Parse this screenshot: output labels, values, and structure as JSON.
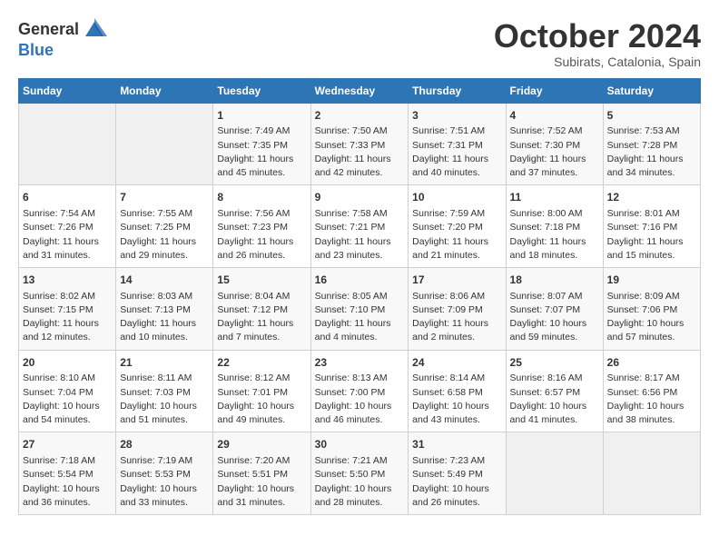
{
  "logo": {
    "line1": "General",
    "line2": "Blue"
  },
  "title": "October 2024",
  "subtitle": "Subirats, Catalonia, Spain",
  "days_of_week": [
    "Sunday",
    "Monday",
    "Tuesday",
    "Wednesday",
    "Thursday",
    "Friday",
    "Saturday"
  ],
  "weeks": [
    [
      {
        "day": "",
        "info": ""
      },
      {
        "day": "",
        "info": ""
      },
      {
        "day": "1",
        "info": "Sunrise: 7:49 AM\nSunset: 7:35 PM\nDaylight: 11 hours and 45 minutes."
      },
      {
        "day": "2",
        "info": "Sunrise: 7:50 AM\nSunset: 7:33 PM\nDaylight: 11 hours and 42 minutes."
      },
      {
        "day": "3",
        "info": "Sunrise: 7:51 AM\nSunset: 7:31 PM\nDaylight: 11 hours and 40 minutes."
      },
      {
        "day": "4",
        "info": "Sunrise: 7:52 AM\nSunset: 7:30 PM\nDaylight: 11 hours and 37 minutes."
      },
      {
        "day": "5",
        "info": "Sunrise: 7:53 AM\nSunset: 7:28 PM\nDaylight: 11 hours and 34 minutes."
      }
    ],
    [
      {
        "day": "6",
        "info": "Sunrise: 7:54 AM\nSunset: 7:26 PM\nDaylight: 11 hours and 31 minutes."
      },
      {
        "day": "7",
        "info": "Sunrise: 7:55 AM\nSunset: 7:25 PM\nDaylight: 11 hours and 29 minutes."
      },
      {
        "day": "8",
        "info": "Sunrise: 7:56 AM\nSunset: 7:23 PM\nDaylight: 11 hours and 26 minutes."
      },
      {
        "day": "9",
        "info": "Sunrise: 7:58 AM\nSunset: 7:21 PM\nDaylight: 11 hours and 23 minutes."
      },
      {
        "day": "10",
        "info": "Sunrise: 7:59 AM\nSunset: 7:20 PM\nDaylight: 11 hours and 21 minutes."
      },
      {
        "day": "11",
        "info": "Sunrise: 8:00 AM\nSunset: 7:18 PM\nDaylight: 11 hours and 18 minutes."
      },
      {
        "day": "12",
        "info": "Sunrise: 8:01 AM\nSunset: 7:16 PM\nDaylight: 11 hours and 15 minutes."
      }
    ],
    [
      {
        "day": "13",
        "info": "Sunrise: 8:02 AM\nSunset: 7:15 PM\nDaylight: 11 hours and 12 minutes."
      },
      {
        "day": "14",
        "info": "Sunrise: 8:03 AM\nSunset: 7:13 PM\nDaylight: 11 hours and 10 minutes."
      },
      {
        "day": "15",
        "info": "Sunrise: 8:04 AM\nSunset: 7:12 PM\nDaylight: 11 hours and 7 minutes."
      },
      {
        "day": "16",
        "info": "Sunrise: 8:05 AM\nSunset: 7:10 PM\nDaylight: 11 hours and 4 minutes."
      },
      {
        "day": "17",
        "info": "Sunrise: 8:06 AM\nSunset: 7:09 PM\nDaylight: 11 hours and 2 minutes."
      },
      {
        "day": "18",
        "info": "Sunrise: 8:07 AM\nSunset: 7:07 PM\nDaylight: 10 hours and 59 minutes."
      },
      {
        "day": "19",
        "info": "Sunrise: 8:09 AM\nSunset: 7:06 PM\nDaylight: 10 hours and 57 minutes."
      }
    ],
    [
      {
        "day": "20",
        "info": "Sunrise: 8:10 AM\nSunset: 7:04 PM\nDaylight: 10 hours and 54 minutes."
      },
      {
        "day": "21",
        "info": "Sunrise: 8:11 AM\nSunset: 7:03 PM\nDaylight: 10 hours and 51 minutes."
      },
      {
        "day": "22",
        "info": "Sunrise: 8:12 AM\nSunset: 7:01 PM\nDaylight: 10 hours and 49 minutes."
      },
      {
        "day": "23",
        "info": "Sunrise: 8:13 AM\nSunset: 7:00 PM\nDaylight: 10 hours and 46 minutes."
      },
      {
        "day": "24",
        "info": "Sunrise: 8:14 AM\nSunset: 6:58 PM\nDaylight: 10 hours and 43 minutes."
      },
      {
        "day": "25",
        "info": "Sunrise: 8:16 AM\nSunset: 6:57 PM\nDaylight: 10 hours and 41 minutes."
      },
      {
        "day": "26",
        "info": "Sunrise: 8:17 AM\nSunset: 6:56 PM\nDaylight: 10 hours and 38 minutes."
      }
    ],
    [
      {
        "day": "27",
        "info": "Sunrise: 7:18 AM\nSunset: 5:54 PM\nDaylight: 10 hours and 36 minutes."
      },
      {
        "day": "28",
        "info": "Sunrise: 7:19 AM\nSunset: 5:53 PM\nDaylight: 10 hours and 33 minutes."
      },
      {
        "day": "29",
        "info": "Sunrise: 7:20 AM\nSunset: 5:51 PM\nDaylight: 10 hours and 31 minutes."
      },
      {
        "day": "30",
        "info": "Sunrise: 7:21 AM\nSunset: 5:50 PM\nDaylight: 10 hours and 28 minutes."
      },
      {
        "day": "31",
        "info": "Sunrise: 7:23 AM\nSunset: 5:49 PM\nDaylight: 10 hours and 26 minutes."
      },
      {
        "day": "",
        "info": ""
      },
      {
        "day": "",
        "info": ""
      }
    ]
  ]
}
